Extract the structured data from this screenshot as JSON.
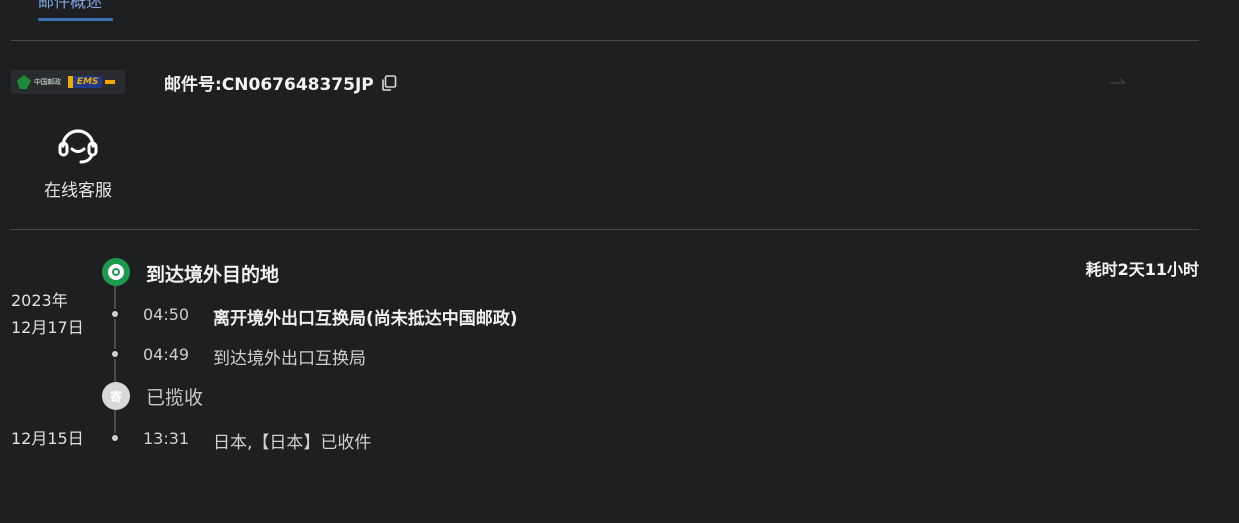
{
  "tab": {
    "label": "邮件概述"
  },
  "header": {
    "mail_number": "邮件号:CN067648375JP",
    "carrier_logo_cn": "中国邮政",
    "carrier_logo_en": "CHINA POST",
    "carrier_logo_ems": "EMS"
  },
  "customer_service": {
    "label": "在线客服"
  },
  "timeline": {
    "duration": "耗时2天11小时",
    "groups": [
      {
        "status": "到达境外目的地",
        "date_year": "2023年",
        "date_day": "12月17日",
        "events": [
          {
            "time": "04:50",
            "desc": "离开境外出口互换局(尚未抵达中国邮政)"
          },
          {
            "time": "04:49",
            "desc": "到达境外出口互换局"
          }
        ]
      },
      {
        "status": "已揽收",
        "status_icon_text": "寄",
        "date_day": "12月15日",
        "events": [
          {
            "time": "13:31",
            "desc": "日本,【日本】已收件"
          }
        ]
      }
    ]
  },
  "colors": {
    "background": "#1e1f21",
    "accent": "#3f6fb5",
    "delivered_green": "#1d9a4f"
  }
}
